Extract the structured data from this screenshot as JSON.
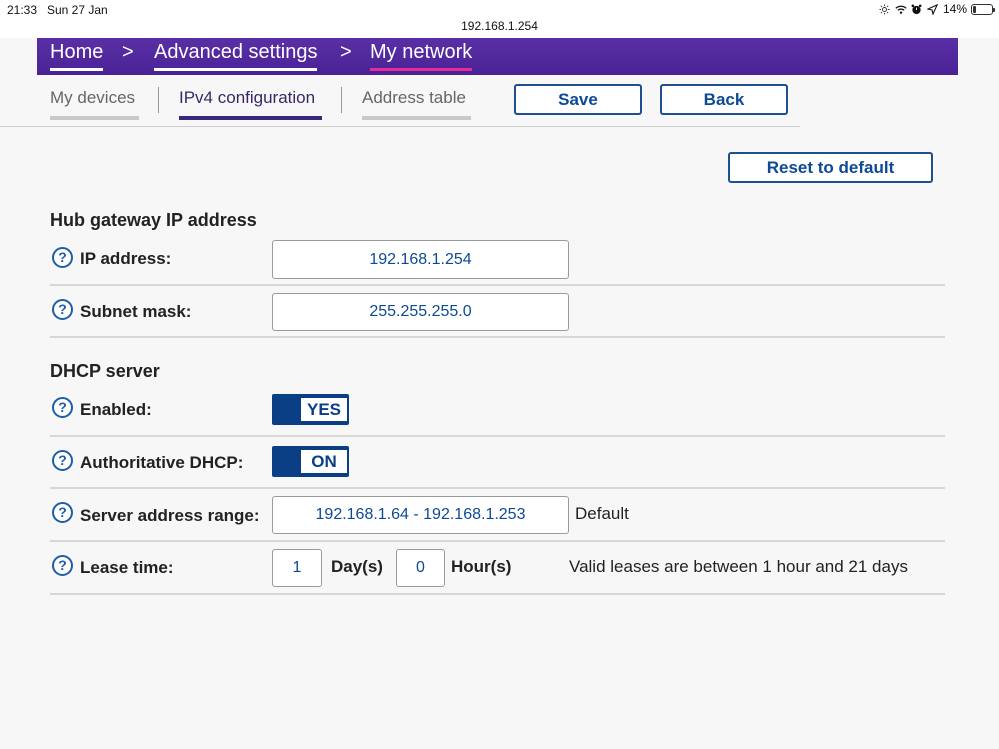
{
  "status_bar": {
    "time": "21:33",
    "date": "Sun 27 Jan",
    "url": "192.168.1.254",
    "battery": "14%",
    "battery_level": 0.14
  },
  "breadcrumb": {
    "home": "Home",
    "separator": ">",
    "advanced": "Advanced settings",
    "current": "My network"
  },
  "tabs": [
    "My devices",
    "IPv4 configuration",
    "Address table"
  ],
  "actions": {
    "save": "Save",
    "back": "Back",
    "reset": "Reset to default"
  },
  "hub_section": {
    "title": "Hub gateway IP address",
    "ip_label": "IP address:",
    "ip_value": "192.168.1.254",
    "subnet_label": "Subnet mask:",
    "subnet_value": "255.255.255.0"
  },
  "dhcp_section": {
    "title": "DHCP server",
    "enabled_label": "Enabled:",
    "enabled_value": "YES",
    "auth_label": "Authoritative DHCP:",
    "auth_value": "ON",
    "range_label": "Server address range:",
    "range_value": "192.168.1.64 - 192.168.1.253",
    "range_note": "Default",
    "lease_label": "Lease time:",
    "lease_days": "1",
    "days_unit": "Day(s)",
    "lease_hours": "0",
    "hours_unit": "Hour(s)",
    "lease_note": "Valid leases are between 1 hour and 21 days"
  },
  "help_glyph": "?",
  "colors": {
    "nav": "#4a2296",
    "accent_underline": "#e62c9b",
    "button_blue": "#0d4a94"
  }
}
